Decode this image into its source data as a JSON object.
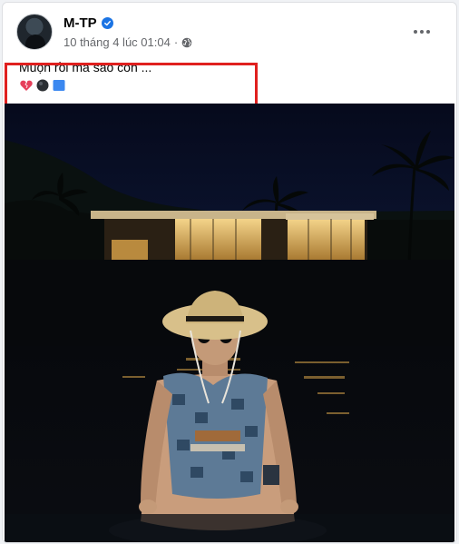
{
  "post": {
    "author": "M-TP",
    "timestamp": "10 tháng 4 lúc 01:04",
    "privacy_icon": "globe-icon",
    "verified_icon": "verified-badge-icon",
    "more_icon": "more-options-icon",
    "caption": "Muộn rồi mà sao còn ...",
    "caption_emojis": [
      "broken-heart-emoji",
      "black-circle-emoji",
      "blue-square-emoji"
    ]
  },
  "colors": {
    "highlight_border": "#e0201f",
    "verified_badge": "#1b74e4",
    "meta_text": "#65676b"
  }
}
